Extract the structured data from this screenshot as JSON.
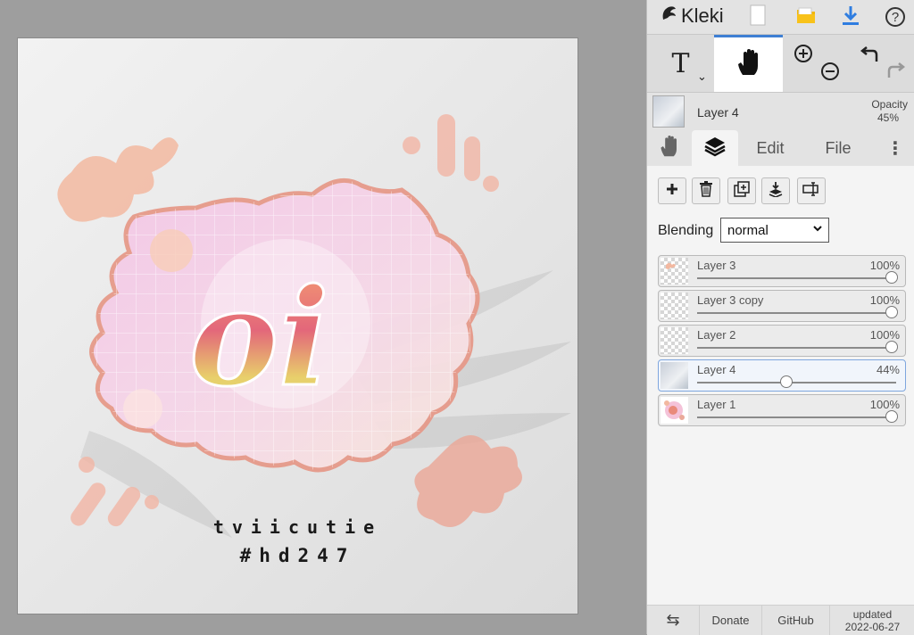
{
  "app": {
    "name": "Kleki"
  },
  "topbar": {
    "logo_icon": "kleki-bird-icon",
    "new_icon": "new-file-icon",
    "open_icon": "folder-icon",
    "save_icon": "download-icon",
    "help_icon": "help-icon",
    "help_glyph": "?"
  },
  "tools": {
    "text_glyph": "T",
    "text_caret": "⌄",
    "active": "hand"
  },
  "current_layer": {
    "name": "Layer 4",
    "opacity_label": "Opacity",
    "opacity_value": "45%"
  },
  "tabs": {
    "edit": "Edit",
    "file": "File",
    "more": "⋮"
  },
  "blending": {
    "label": "Blending",
    "value": "normal"
  },
  "layers": [
    {
      "name": "Layer 3",
      "opacity": "100%",
      "level": 1.0,
      "active": false
    },
    {
      "name": "Layer 3 copy",
      "opacity": "100%",
      "level": 1.0,
      "active": false
    },
    {
      "name": "Layer 2",
      "opacity": "100%",
      "level": 1.0,
      "active": false
    },
    {
      "name": "Layer 4",
      "opacity": "44%",
      "level": 0.44,
      "active": true
    },
    {
      "name": "Layer 1",
      "opacity": "100%",
      "level": 1.0,
      "active": false
    }
  ],
  "artwork": {
    "logo_text": "oi",
    "username": "tviicutie",
    "hashtag": "#hd247"
  },
  "footer": {
    "swap_glyph": "⇆",
    "donate": "Donate",
    "github": "GitHub",
    "updated_label": "updated",
    "updated_date": "2022-06-27"
  },
  "colors": {
    "accent": "#3e7fd3",
    "active_layer_border": "#7ea6de"
  }
}
